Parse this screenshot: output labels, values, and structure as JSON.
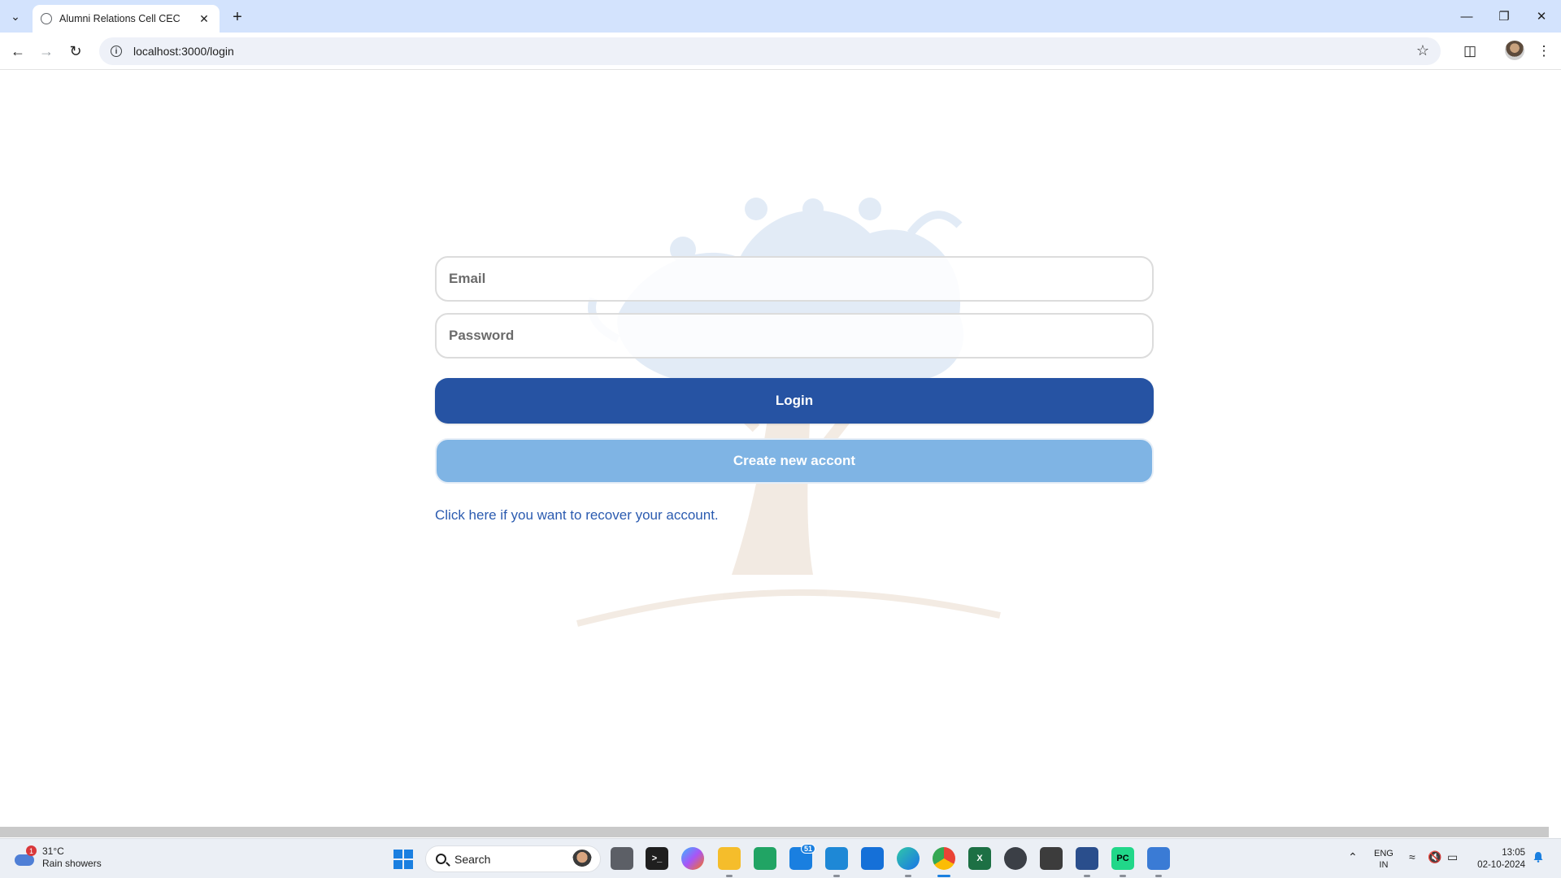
{
  "browser": {
    "tab_title": "Alumni Relations Cell CEC",
    "url": "localhost:3000/login"
  },
  "login_form": {
    "email_placeholder": "Email",
    "password_placeholder": "Password",
    "login_label": "Login",
    "create_label": "Create new accont",
    "recover_link": "Click here if you want to recover your account."
  },
  "colors": {
    "login_button": "#2653a3",
    "create_button": "#7fb4e4",
    "link": "#2b5bb0"
  },
  "taskbar": {
    "weather_temp": "31°C",
    "weather_desc": "Rain showers",
    "weather_badge": "1",
    "search_label": "Search",
    "mail_badge": "51",
    "lang_top": "ENG",
    "lang_bottom": "IN",
    "time": "13:05",
    "date": "02-10-2024",
    "apps": [
      "task-view",
      "terminal",
      "copilot",
      "file-explorer",
      "sheets",
      "mail",
      "vscode",
      "store",
      "edge",
      "chrome",
      "excel",
      "camera",
      "app",
      "snipping",
      "pycharm",
      "notepad"
    ]
  }
}
